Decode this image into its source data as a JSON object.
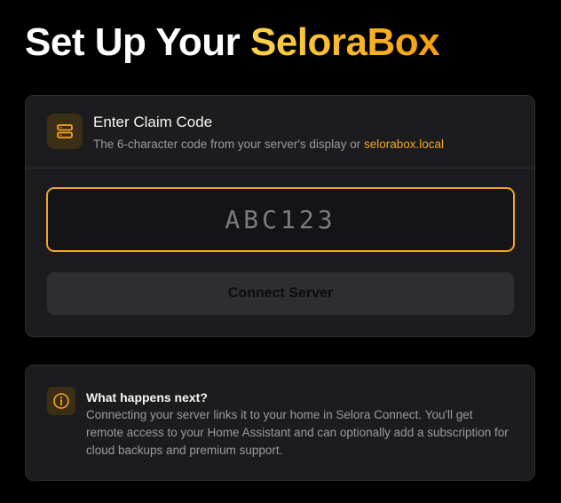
{
  "header": {
    "title_prefix": "Set Up Your ",
    "title_brand": "SeloraBox"
  },
  "claim": {
    "title": "Enter Claim Code",
    "subtitle_text": "The 6-character code from your server's display or ",
    "subtitle_link": "selorabox.local",
    "input_value": "",
    "input_placeholder": "ABC123",
    "connect_label": "Connect Server",
    "icon": "server-icon"
  },
  "info": {
    "title": "What happens next?",
    "body": "Connecting your server links it to your home in Selora Connect. You'll get remote access to your Home Assistant and can optionally add a subscription for cloud backups and premium support.",
    "icon": "info-icon"
  },
  "colors": {
    "accent": "#f5a524",
    "brand_gradient_start": "#fcd34d",
    "brand_gradient_end": "#f59e0b",
    "background": "#000000",
    "card": "#1c1c1e"
  }
}
